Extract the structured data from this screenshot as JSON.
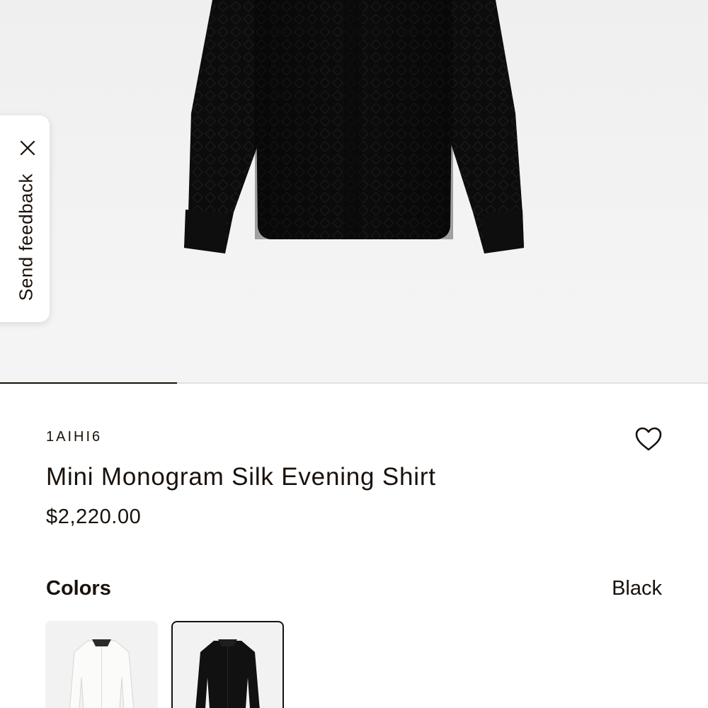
{
  "feedback": {
    "label": "Send feedback"
  },
  "carousel": {
    "progress_fraction": 0.25
  },
  "product": {
    "sku": "1AIHI6",
    "name": "Mini Monogram Silk Evening Shirt",
    "price": "$2,220.00"
  },
  "colors": {
    "label": "Colors",
    "selected": "Black",
    "options": [
      {
        "name": "White",
        "swatch": "#f7f7f5"
      },
      {
        "name": "Black",
        "swatch": "#111111"
      }
    ]
  },
  "icons": {
    "close": "close-icon",
    "wishlist": "heart-icon"
  },
  "theme": {
    "text": "#19110b",
    "background": "#ffffff",
    "hero_background": "#f1f1f1"
  }
}
